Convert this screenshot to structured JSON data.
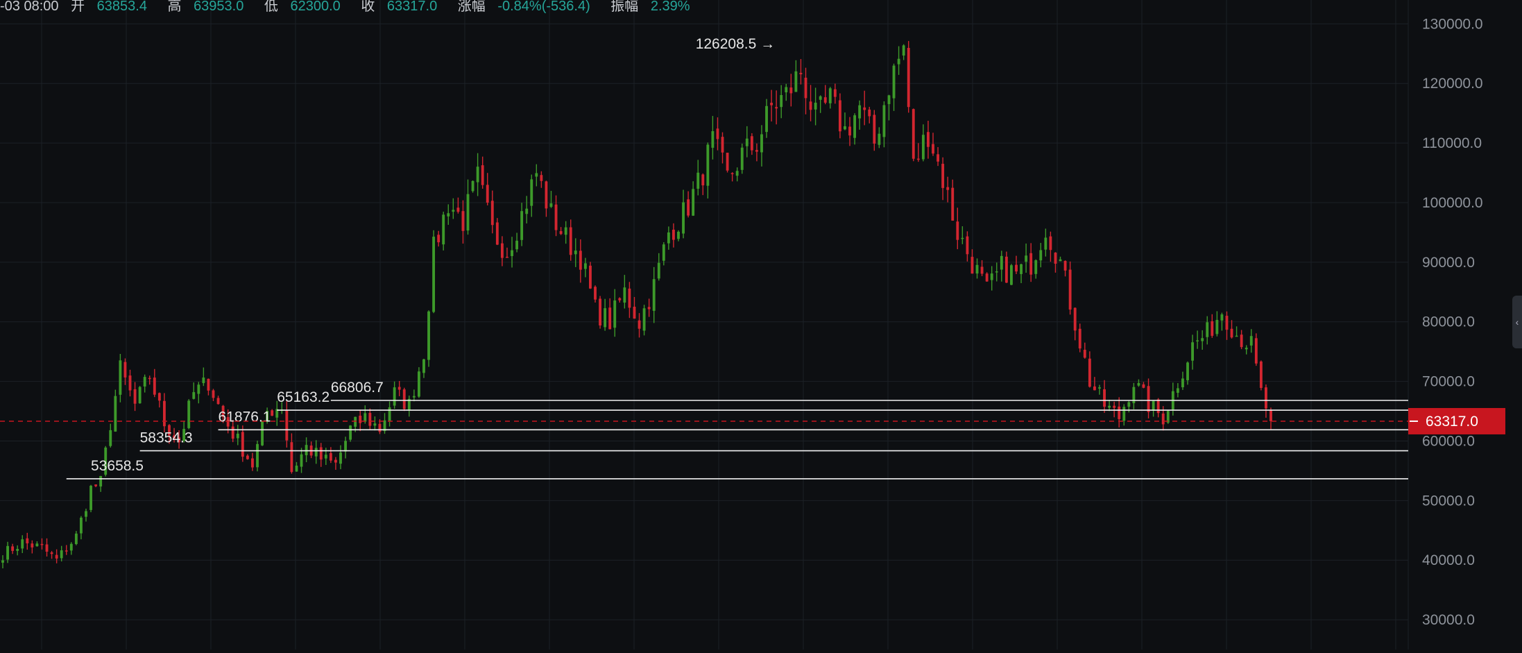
{
  "info_bar": {
    "time": "-03 08:00",
    "open_label": "开",
    "open": "63853.4",
    "high_label": "高",
    "high": "63953.0",
    "low_label": "低",
    "low": "62300.0",
    "close_label": "收",
    "close": "63317.0",
    "change_label": "涨幅",
    "change": "-0.84%(-536.4)",
    "amplitude_label": "振幅",
    "amplitude": "2.39%"
  },
  "colors": {
    "background": "#0d0f12",
    "grid": "#1c2027",
    "up": "#3d9a2a",
    "down": "#d32630",
    "axis_text": "#8e939b",
    "label_text": "#e6e6e6",
    "price_tag": "#c8161f"
  },
  "chart_data": {
    "type": "candlestick",
    "title": "",
    "ylim": [
      25000,
      134000
    ],
    "y_ticks": [
      "130000.0",
      "120000.0",
      "110000.0",
      "100000.0",
      "90000.0",
      "80000.0",
      "70000.0",
      "60000.0",
      "50000.0",
      "40000.0",
      "30000.0"
    ],
    "grid": true,
    "current_price": {
      "value": 63317.0,
      "label": "63317.0"
    },
    "annotations": [
      {
        "label": "126208.5",
        "value": 126208.5,
        "x_index": 158,
        "arrow": "→"
      },
      {
        "label": "53658.5",
        "value": 53658.5,
        "x_index": 18
      },
      {
        "label": "58354.3",
        "value": 58354.3,
        "x_index": 28
      },
      {
        "label": "61876.1",
        "value": 61876.1,
        "x_index": 44
      },
      {
        "label": "65163.2",
        "value": 65163.2,
        "x_index": 56
      },
      {
        "label": "66806.7",
        "value": 66806.7,
        "x_index": 67
      }
    ],
    "horizontal_levels": [
      {
        "value": 66806.7,
        "x_start_index": 67
      },
      {
        "value": 65163.2,
        "x_start_index": 56
      },
      {
        "value": 61876.1,
        "x_start_index": 44
      },
      {
        "value": 58354.3,
        "x_start_index": 28
      },
      {
        "value": 53658.5,
        "x_start_index": 13
      }
    ],
    "close_path": [
      [
        0,
        41000
      ],
      [
        4,
        43000
      ],
      [
        8,
        42000
      ],
      [
        11,
        40000
      ],
      [
        15,
        44000
      ],
      [
        18,
        52000
      ],
      [
        20,
        53000
      ],
      [
        22,
        63000
      ],
      [
        24,
        72000
      ],
      [
        27,
        66000
      ],
      [
        30,
        71000
      ],
      [
        33,
        63000
      ],
      [
        36,
        60000
      ],
      [
        39,
        68000
      ],
      [
        42,
        70000
      ],
      [
        45,
        64000
      ],
      [
        48,
        60000
      ],
      [
        51,
        56000
      ],
      [
        54,
        65000
      ],
      [
        57,
        66000
      ],
      [
        59,
        55000
      ],
      [
        62,
        59000
      ],
      [
        65,
        57000
      ],
      [
        68,
        56000
      ],
      [
        71,
        62000
      ],
      [
        74,
        64000
      ],
      [
        77,
        62000
      ],
      [
        80,
        68000
      ],
      [
        83,
        66000
      ],
      [
        86,
        75000
      ],
      [
        88,
        92000
      ],
      [
        91,
        100000
      ],
      [
        94,
        97000
      ],
      [
        97,
        104000
      ],
      [
        100,
        95000
      ],
      [
        103,
        92000
      ],
      [
        106,
        98000
      ],
      [
        109,
        105000
      ],
      [
        112,
        98000
      ],
      [
        115,
        94000
      ],
      [
        118,
        91000
      ],
      [
        121,
        82000
      ],
      [
        124,
        80000
      ],
      [
        127,
        85000
      ],
      [
        130,
        80000
      ],
      [
        133,
        86000
      ],
      [
        136,
        95000
      ],
      [
        139,
        98000
      ],
      [
        142,
        103000
      ],
      [
        145,
        110000
      ],
      [
        148,
        104000
      ],
      [
        151,
        108000
      ],
      [
        154,
        110000
      ],
      [
        157,
        116000
      ],
      [
        160,
        118000
      ],
      [
        163,
        122000
      ],
      [
        166,
        114000
      ],
      [
        169,
        117000
      ],
      [
        172,
        112000
      ],
      [
        175,
        116000
      ],
      [
        178,
        110000
      ],
      [
        181,
        120000
      ],
      [
        184,
        126000
      ],
      [
        186,
        106000
      ],
      [
        189,
        112000
      ],
      [
        192,
        104000
      ],
      [
        195,
        95000
      ],
      [
        198,
        90000
      ],
      [
        201,
        85000
      ],
      [
        204,
        89000
      ],
      [
        207,
        88000
      ],
      [
        210,
        90000
      ],
      [
        213,
        96000
      ],
      [
        216,
        90000
      ],
      [
        219,
        80000
      ],
      [
        222,
        70000
      ],
      [
        225,
        66000
      ],
      [
        228,
        64000
      ],
      [
        231,
        70000
      ],
      [
        234,
        66000
      ],
      [
        237,
        64000
      ],
      [
        240,
        70000
      ],
      [
        243,
        76000
      ],
      [
        246,
        78000
      ],
      [
        249,
        82000
      ],
      [
        252,
        78000
      ],
      [
        255,
        76000
      ],
      [
        257,
        68000
      ],
      [
        259,
        63317
      ]
    ]
  }
}
